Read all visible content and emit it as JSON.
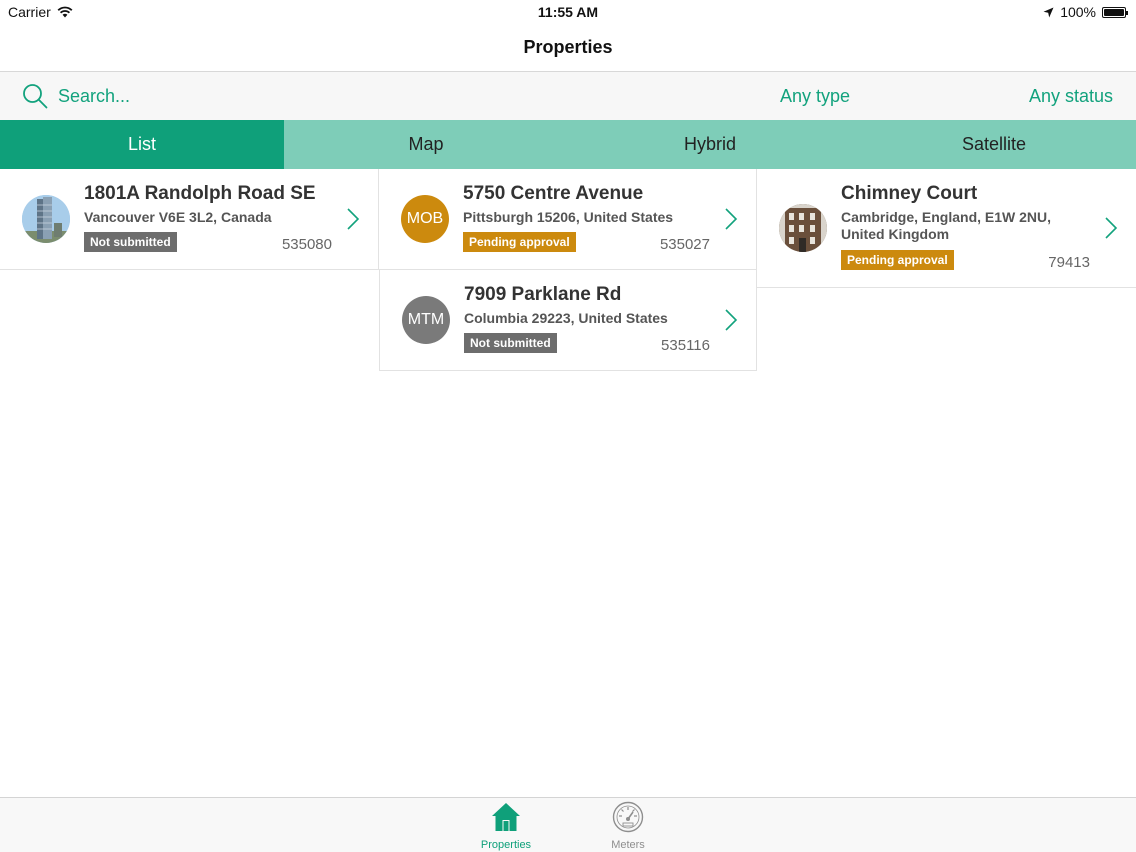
{
  "status_bar": {
    "carrier": "Carrier",
    "time": "11:55 AM",
    "battery": "100%"
  },
  "nav": {
    "title": "Properties"
  },
  "search": {
    "placeholder": "Search...",
    "type_filter": "Any type",
    "status_filter": "Any status"
  },
  "tabs": [
    {
      "label": "List",
      "active": true
    },
    {
      "label": "Map",
      "active": false
    },
    {
      "label": "Hybrid",
      "active": false
    },
    {
      "label": "Satellite",
      "active": false
    }
  ],
  "properties": [
    {
      "title": "1801A Randolph Road SE",
      "address": "Vancouver  V6E 3L2, Canada",
      "status": "Not submitted",
      "id": "535080",
      "avatar": "tower-photo"
    },
    {
      "title": "5750 Centre Avenue",
      "address": "Pittsburgh 15206, United States",
      "status": "Pending approval",
      "id": "535027",
      "avatar_text": "MOB"
    },
    {
      "title": "Chimney Court",
      "address": "Cambridge, England, E1W 2NU, United Kingdom",
      "status": "Pending approval",
      "id": "79413",
      "avatar": "brick-building-photo"
    },
    {
      "title": "7909 Parklane Rd",
      "address": "Columbia 29223, United States",
      "status": "Not submitted",
      "id": "535116",
      "avatar_text": "MTM"
    }
  ],
  "tab_bar": [
    {
      "label": "Properties",
      "icon": "house-icon",
      "active": true
    },
    {
      "label": "Meters",
      "icon": "gauge-icon",
      "active": false
    }
  ],
  "colors": {
    "accent": "#0fa07a",
    "tab_inactive": "#7ecdb8",
    "badge_grey": "#6d6d6d",
    "badge_orange": "#cc8a0e",
    "avatar_mob": "#cc8a0e",
    "avatar_mtm": "#7a7a7a"
  }
}
